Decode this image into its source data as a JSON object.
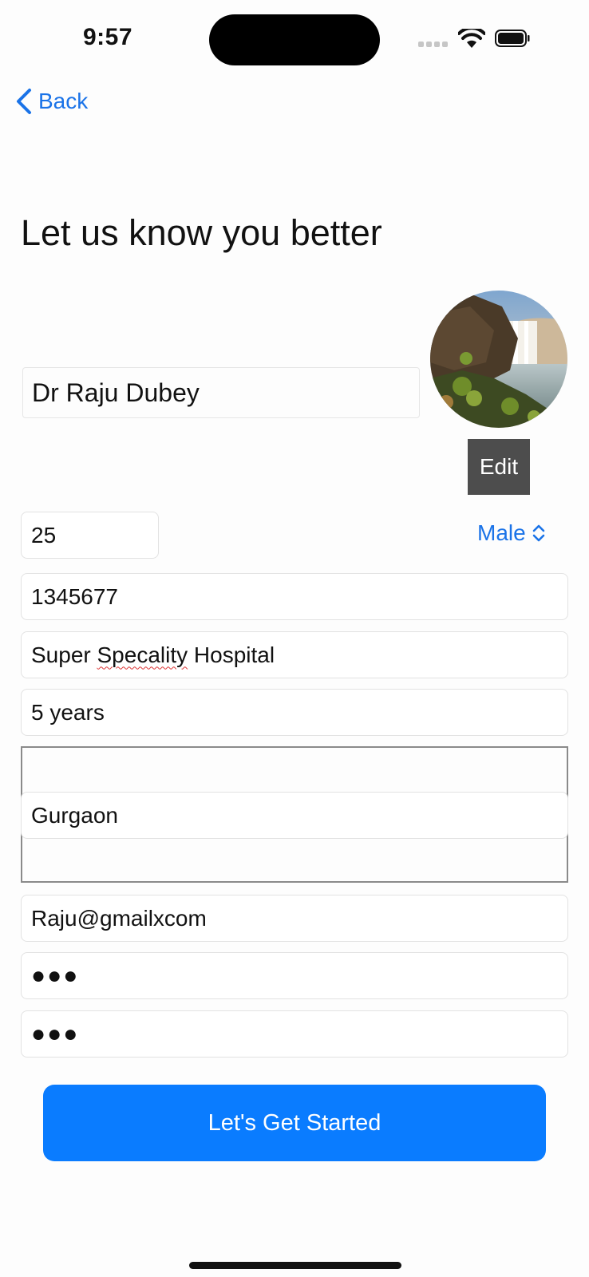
{
  "status_bar": {
    "time": "9:57"
  },
  "nav": {
    "back_label": "Back"
  },
  "title": "Let us know you better",
  "profile": {
    "name": "Dr Raju Dubey",
    "edit_label": "Edit"
  },
  "form": {
    "age": "25",
    "gender": "Male",
    "registration_number": "1345677",
    "hospital": {
      "part1": "Super ",
      "part2": "Specality",
      "part3": " Hospital"
    },
    "experience": "5 years",
    "city": "Gurgaon",
    "email": "Raju@gmailxcom",
    "password_mask": "●●●",
    "confirm_password_mask": "●●●"
  },
  "cta_label": "Let's Get Started",
  "colors": {
    "accent": "#0a7cff",
    "link": "#1a73e8",
    "edit_bg": "#4d4d4d"
  }
}
